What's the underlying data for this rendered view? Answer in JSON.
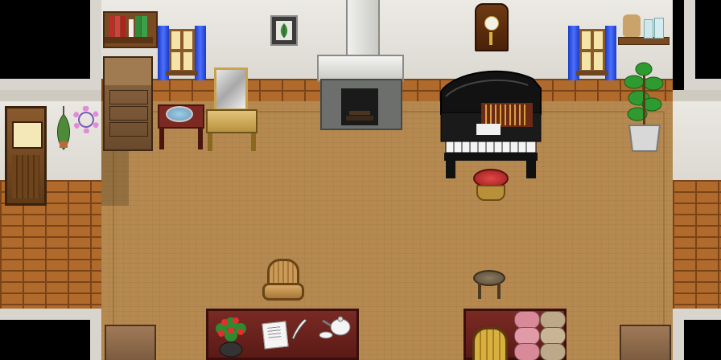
{
  "scene": {
    "type": "rpg-interior",
    "room": "mansion-parlor",
    "colors": {
      "floor": "#b5894f",
      "wall": "#e6e3dc",
      "brick": "#b06a2c",
      "curtain": "#2f55e6",
      "piano": "#111111",
      "void": "#000000"
    },
    "objects": [
      "bookshelf",
      "potted-plant-painting",
      "fireplace",
      "pendulum-clock",
      "wall-shelf-with-jars",
      "window-left",
      "window-right",
      "dresser",
      "wash-basin-table",
      "vanity-mirror",
      "grand-piano",
      "piano-stool",
      "potted-tree",
      "wooden-door",
      "flower-wreath",
      "hanging-herbs",
      "armchair",
      "round-stool",
      "writing-desk",
      "flower-vase",
      "papers-and-quill",
      "teapot",
      "side-table",
      "rolled-towels",
      "barrel"
    ]
  }
}
